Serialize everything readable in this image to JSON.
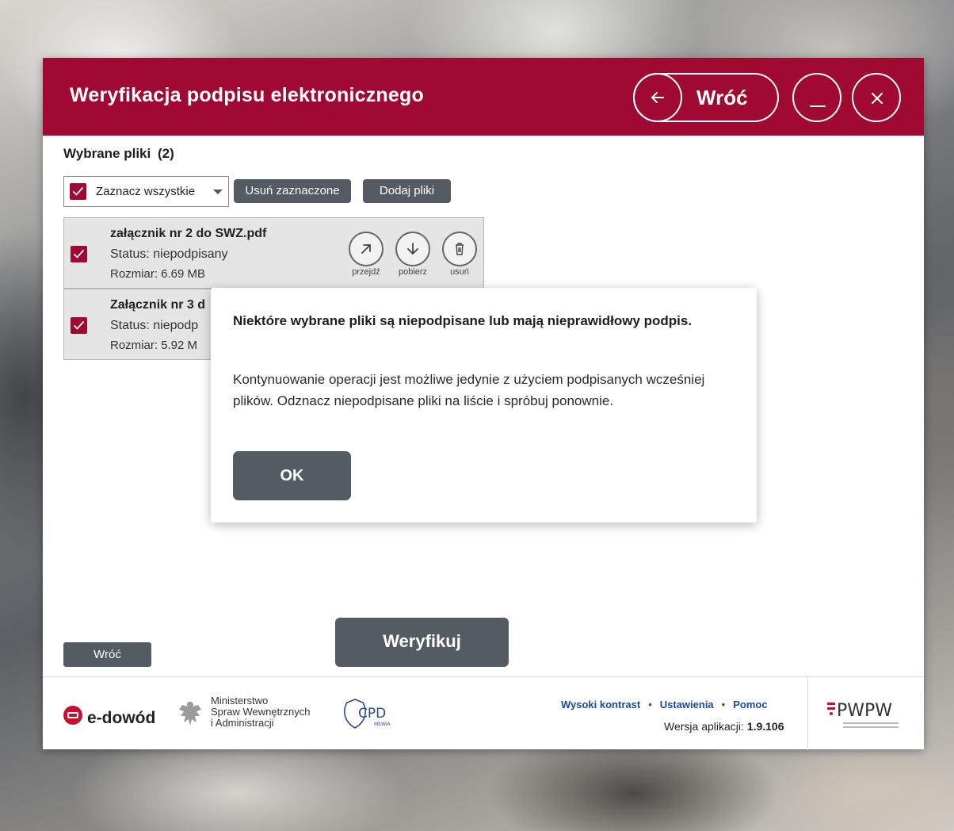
{
  "header": {
    "title": "Weryfikacja podpisu elektronicznego",
    "back_label": "Wróć"
  },
  "files": {
    "section_title": "Wybrane pliki",
    "count": "(2)",
    "select_all_label": "Zaznacz wszystkie",
    "remove_selected_label": "Usuń zaznaczone",
    "add_files_label": "Dodaj pliki",
    "items": [
      {
        "name": "załącznik nr 2 do SWZ.pdf",
        "status": "Status: niepodpisany",
        "size": "Rozmiar: 6.69 MB",
        "checked": true
      },
      {
        "name": "Załącznik nr 3 d",
        "status": "Status: niepodp",
        "size": "Rozmiar: 5.92 M",
        "checked": true
      }
    ],
    "actions": {
      "open": "przejdź",
      "download": "pobierz",
      "delete": "usuń"
    }
  },
  "bottom": {
    "back_label": "Wróć",
    "verify_label": "Weryfikuj"
  },
  "footer": {
    "edowod": "e-dowód",
    "mswia_line1": "Ministerstwo",
    "mswia_line2": "Spraw Wewnętrznych",
    "mswia_line3": "i Administracji",
    "link_high_contrast": "Wysoki kontrast",
    "link_settings": "Ustawienia",
    "link_help": "Pomoc",
    "version_label": "Wersja aplikacji:",
    "version_value": "1.9.106",
    "pwpw": "PWPW"
  },
  "dialog": {
    "title": "Niektóre wybrane pliki są niepodpisane lub mają nieprawidłowy podpis.",
    "body": "Kontynuowanie operacji jest możliwe jedynie z użyciem podpisanych wcześniej plików. Odznacz niepodpisane pliki na liście i spróbuj ponownie.",
    "ok_label": "OK"
  },
  "colors": {
    "brand": "#a00a32",
    "button_dark": "#545b63",
    "link": "#1a4aa0"
  }
}
